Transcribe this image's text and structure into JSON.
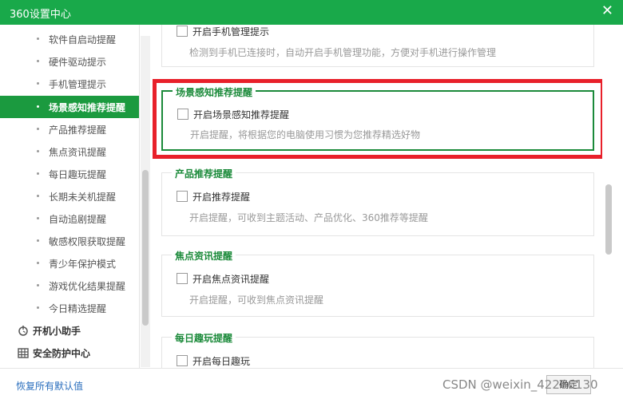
{
  "window": {
    "title": "360设置中心",
    "close": "✕"
  },
  "sidebar": {
    "items": [
      {
        "label": "软件自启动提醒"
      },
      {
        "label": "硬件驱动提示"
      },
      {
        "label": "手机管理提示"
      },
      {
        "label": "场景感知推荐提醒",
        "active": true
      },
      {
        "label": "产品推荐提醒"
      },
      {
        "label": "焦点资讯提醒"
      },
      {
        "label": "每日趣玩提醒"
      },
      {
        "label": "长期未关机提醒"
      },
      {
        "label": "自动追剧提醒"
      },
      {
        "label": "敏感权限获取提醒"
      },
      {
        "label": "青少年保护模式"
      },
      {
        "label": "游戏优化结果提醒"
      },
      {
        "label": "今日精选提醒"
      }
    ],
    "groups": [
      {
        "label": "开机小助手",
        "icon": "power-clock-icon"
      },
      {
        "label": "安全防护中心",
        "icon": "shield-grid-icon"
      }
    ]
  },
  "sections": [
    {
      "legend": "",
      "checkbox": "开启手机管理提示",
      "desc": "检测到手机已连接时，自动开启手机管理功能，方便对手机进行操作管理",
      "checked": false
    },
    {
      "legend": "场景感知推荐提醒",
      "checkbox": "开启场景感知推荐提醒",
      "desc": "开启提醒，将根据您的电脑使用习惯为您推荐精选好物",
      "checked": false
    },
    {
      "legend": "产品推荐提醒",
      "checkbox": "开启推荐提醒",
      "desc": "开启提醒，可收到主题活动、产品优化、360推荐等提醒",
      "checked": false
    },
    {
      "legend": "焦点资讯提醒",
      "checkbox": "开启焦点资讯提醒",
      "desc": "开启提醒，可收到焦点资讯提醒",
      "checked": false
    },
    {
      "legend": "每日趣玩提醒",
      "checkbox": "开启每日趣玩",
      "desc": "",
      "checked": false
    }
  ],
  "footer": {
    "reset": "恢复所有默认值",
    "ok": "确定",
    "watermark": "CSDN @weixin_42266130"
  },
  "colors": {
    "brand": "#19a94a",
    "active": "#1b9a3f",
    "highlight": "#e8202a",
    "legend": "#1b8a3a"
  }
}
